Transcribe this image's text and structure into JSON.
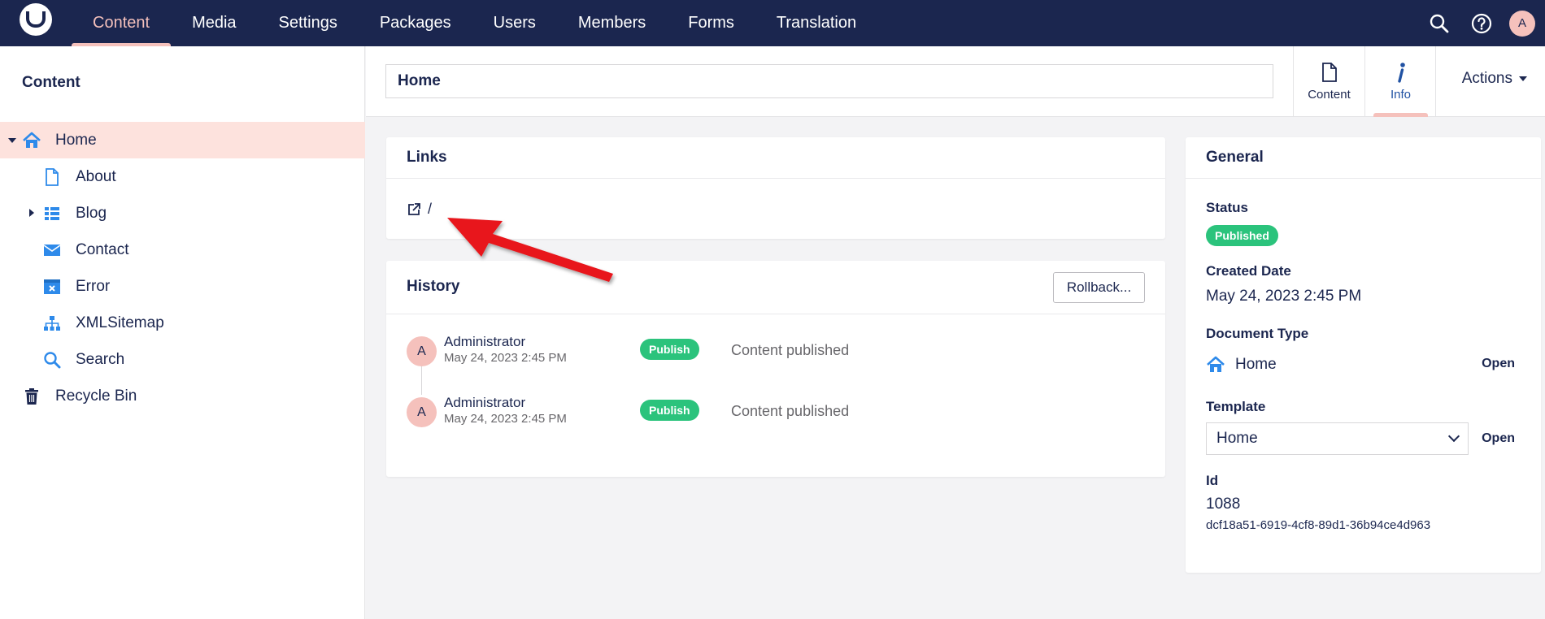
{
  "topbar": {
    "avatar_initial": "A",
    "nav": [
      {
        "label": "Content",
        "active": true
      },
      {
        "label": "Media"
      },
      {
        "label": "Settings"
      },
      {
        "label": "Packages"
      },
      {
        "label": "Users"
      },
      {
        "label": "Members"
      },
      {
        "label": "Forms"
      },
      {
        "label": "Translation"
      }
    ],
    "icons": [
      "search-icon",
      "help-icon"
    ],
    "accent_color": "#f5c1bc",
    "bg_color": "#1b264f"
  },
  "sidebar": {
    "title": "Content",
    "items": [
      {
        "label": "Home",
        "icon": "home-icon",
        "selected": true,
        "expanded": true
      },
      {
        "label": "About",
        "icon": "document-icon"
      },
      {
        "label": "Blog",
        "icon": "list-icon",
        "has_children": true
      },
      {
        "label": "Contact",
        "icon": "mail-icon"
      },
      {
        "label": "Error",
        "icon": "error-page-icon"
      },
      {
        "label": "XMLSitemap",
        "icon": "sitemap-icon"
      },
      {
        "label": "Search",
        "icon": "search-icon"
      },
      {
        "label": "Recycle Bin",
        "icon": "trash-icon"
      }
    ]
  },
  "header": {
    "name_value": "Home",
    "apps": [
      {
        "label": "Content",
        "icon": "document-icon"
      },
      {
        "label": "Info",
        "icon": "info-icon",
        "active": true
      }
    ],
    "actions_label": "Actions"
  },
  "links": {
    "title": "Links",
    "url": "/"
  },
  "history": {
    "title": "History",
    "rollback_label": "Rollback...",
    "entries": [
      {
        "initial": "A",
        "user": "Administrator",
        "date": "May 24, 2023 2:45 PM",
        "badge": "Publish",
        "description": "Content published"
      },
      {
        "initial": "A",
        "user": "Administrator",
        "date": "May 24, 2023 2:45 PM",
        "badge": "Publish",
        "description": "Content published"
      }
    ]
  },
  "general": {
    "title": "General",
    "status_label": "Status",
    "status_value": "Published",
    "created_label": "Created Date",
    "created_value": "May 24, 2023 2:45 PM",
    "doctype_label": "Document Type",
    "doctype_value": "Home",
    "doctype_open": "Open",
    "template_label": "Template",
    "template_value": "Home",
    "template_open": "Open",
    "id_label": "Id",
    "id_value": "1088",
    "guid_value": "dcf18a51-6919-4cf8-89d1-36b94ce4d963"
  },
  "colors": {
    "published_green": "#2bc37c",
    "selected_row": "#fde2dd",
    "icon_blue": "#2e8aea",
    "annotation_red": "#e8141a"
  }
}
